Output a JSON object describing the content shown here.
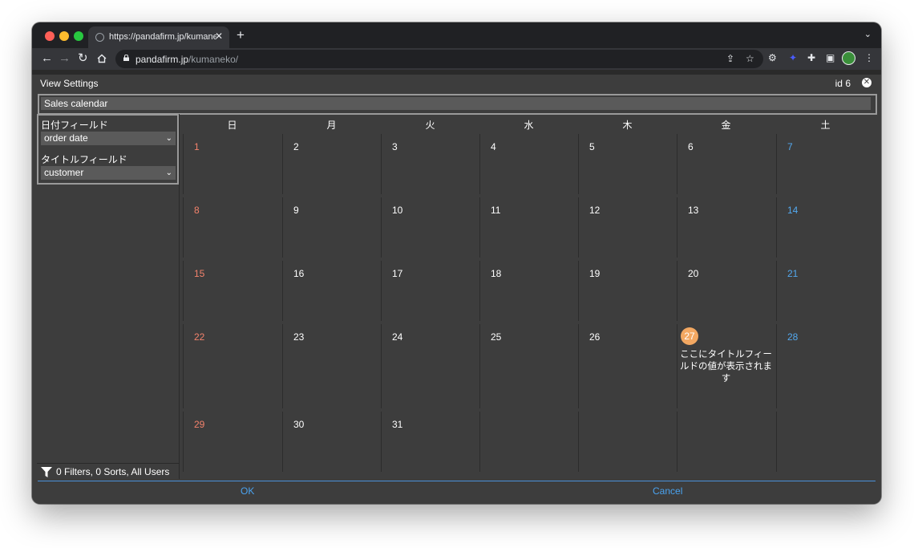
{
  "browser": {
    "tab_title": "https://pandafirm.jp/kumaneko/",
    "tab_close": "✕",
    "new_tab": "+",
    "tab_menu": "⌄",
    "url_host": "pandafirm.jp",
    "url_path": "/kumaneko/"
  },
  "dialog": {
    "title": "View Settings",
    "id_label": "id 6",
    "close_glyph": "✕",
    "view_name": "Sales calendar"
  },
  "settings": {
    "date_field_label": "日付フィールド",
    "date_field_value": "order date",
    "title_field_label": "タイトルフィールド",
    "title_field_value": "customer"
  },
  "filter_summary": "0 Filters, 0 Sorts, All Users",
  "calendar": {
    "weekdays": [
      "日",
      "月",
      "火",
      "水",
      "木",
      "金",
      "土"
    ],
    "weeks": [
      [
        "1",
        "2",
        "3",
        "4",
        "5",
        "6",
        "7"
      ],
      [
        "8",
        "9",
        "10",
        "11",
        "12",
        "13",
        "14"
      ],
      [
        "15",
        "16",
        "17",
        "18",
        "19",
        "20",
        "21"
      ],
      [
        "22",
        "23",
        "24",
        "25",
        "26",
        "27",
        "28"
      ],
      [
        "29",
        "30",
        "31",
        "",
        "",
        "",
        ""
      ]
    ],
    "today": "27",
    "event_text": "ここにタイトルフィールドの値が表示されます"
  },
  "footer": {
    "ok_label": "OK",
    "cancel_label": "Cancel"
  },
  "colors": {
    "sunday": "#f2826c",
    "saturday": "#53a8ee",
    "today_badge": "#f3a862",
    "accent": "#4aa3f0"
  }
}
